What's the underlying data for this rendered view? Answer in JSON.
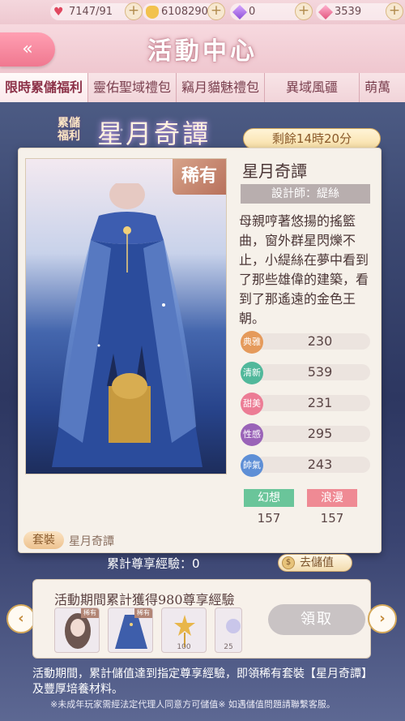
{
  "currency": {
    "stamina": "7147/91",
    "gold": "6108290",
    "diamond": "0",
    "pink_diamond": "3539"
  },
  "header": {
    "back_icon": "«",
    "title": "活動中心"
  },
  "tabs": [
    "限時累儲福利",
    "靈佑聖域禮包",
    "竊月貓魅禮包",
    "異域風疆",
    "萌萬"
  ],
  "event": {
    "badge_line1": "累儲",
    "badge_line2": "福利",
    "title": "星月奇譚",
    "timer": "剩餘14時20分"
  },
  "item": {
    "rarity": "稀有",
    "name": "星月奇譚",
    "designer": "設計師：緹絲",
    "description": "母親哼著悠揚的搖籃曲，窗外群星閃爍不止，小緹絲在夢中看到了那些雄偉的建築，看到了那遙遠的金色王朝。",
    "stats": [
      {
        "label": "典雅",
        "value": "230",
        "color": "#e59a5b"
      },
      {
        "label": "清新",
        "value": "539",
        "color": "#51b89b"
      },
      {
        "label": "甜美",
        "value": "231",
        "color": "#ec7c95"
      },
      {
        "label": "性感",
        "value": "295",
        "color": "#9a63b8"
      },
      {
        "label": "帥氣",
        "value": "243",
        "color": "#5e8fd6"
      }
    ],
    "tags": [
      {
        "label": "幻想",
        "value": "157",
        "color": "#6ac59a"
      },
      {
        "label": "浪漫",
        "value": "157",
        "color": "#ef8a94"
      }
    ],
    "suit_label": "套裝",
    "suit_name": "星月奇譚"
  },
  "exp": {
    "label": "累計尊享經驗：0",
    "topup_label": "去儲值",
    "coin_icon": "$"
  },
  "reward": {
    "title": "活動期間累計獲得980尊享經驗",
    "items": [
      {
        "tag": "稀有",
        "qty": ""
      },
      {
        "tag": "稀有",
        "qty": ""
      },
      {
        "tag": "",
        "qty": "100"
      },
      {
        "tag": "",
        "qty": "25"
      }
    ],
    "claim_label": "領取"
  },
  "arrows": {
    "left": "‹",
    "right": "›"
  },
  "notes": {
    "main": "活動期間，累計儲值達到指定尊享經驗，即領稀有套裝【星月奇譚】及豐厚培養材料。",
    "small": "※未成年玩家需經法定代理人同意方可儲值※ 如遇儲值問題請聯繫客服。"
  },
  "colors": {
    "accent_pink": "#f07890",
    "gold": "#d4a85a",
    "card_bg": "#f6f1ea"
  }
}
